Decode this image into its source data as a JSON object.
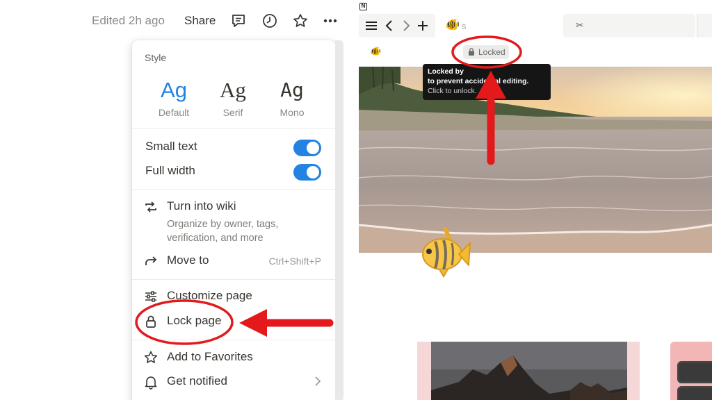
{
  "left_panel": {
    "topbar": {
      "edited_text": "Edited 2h ago",
      "share_label": "Share",
      "icons": [
        "comment-icon",
        "clock-icon",
        "star-icon",
        "more-icon"
      ]
    },
    "menu": {
      "style_label": "Style",
      "fonts": [
        {
          "sample": "Ag",
          "name": "Default",
          "selected": true
        },
        {
          "sample": "Ag",
          "name": "Serif",
          "selected": false
        },
        {
          "sample": "Ag",
          "name": "Mono",
          "selected": false
        }
      ],
      "toggles": [
        {
          "label": "Small text",
          "on": true
        },
        {
          "label": "Full width",
          "on": true
        }
      ],
      "turn_into_wiki": {
        "label": "Turn into wiki",
        "desc_line1": "Organize by owner, tags,",
        "desc_line2": "verification, and more"
      },
      "move_to": {
        "label": "Move to",
        "shortcut": "Ctrl+Shift+P"
      },
      "customize_page": {
        "label": "Customize page"
      },
      "lock_page": {
        "label": "Lock page"
      },
      "add_to_favorites": {
        "label": "Add to Favorites"
      },
      "get_notified": {
        "label": "Get notified"
      }
    }
  },
  "right_panel": {
    "app_logo": "N",
    "tab_title_fragment": "s",
    "locked_badge": "Locked",
    "tooltip": {
      "line1": "Locked by",
      "line2": "to prevent accidental editing.",
      "line3": "Click to unlock."
    }
  },
  "colors": {
    "accent_blue": "#2383e2",
    "annotation_red": "#e3191c",
    "tooltip_bg": "#151515"
  }
}
